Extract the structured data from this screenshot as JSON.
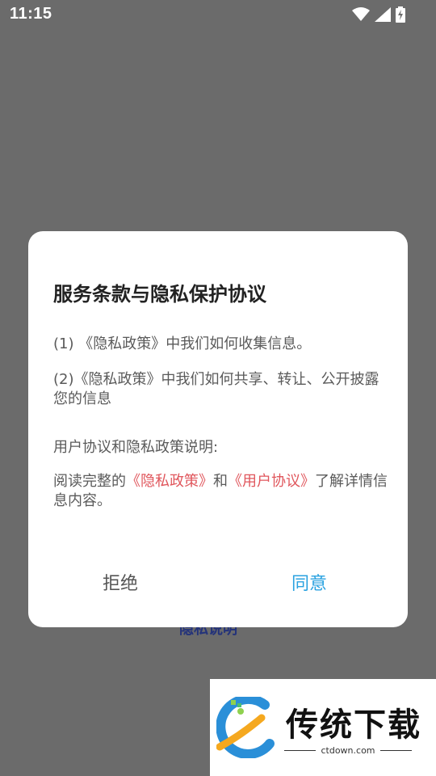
{
  "status_bar": {
    "time": "11:15",
    "icons": [
      "wifi-icon",
      "signal-icon",
      "battery-charging-icon"
    ]
  },
  "background_snippet": "隐私说明",
  "dialog": {
    "title": "服务条款与隐私保护协议",
    "item1": "(1) 《隐私政策》中我们如何收集信息。",
    "item2": "(2)《隐私政策》中我们如何共享、转让、公开披露您的信息",
    "section_label": "用户协议和隐私政策说明:",
    "read_prefix": "阅读完整的",
    "privacy_link": "《隐私政策》",
    "and_text": "和",
    "user_link": "《用户协议》",
    "read_suffix": "了解详情信息内容。",
    "reject_label": "拒绝",
    "agree_label": "同意"
  },
  "colors": {
    "overlay": "#6b6b6b",
    "link": "#e0565c",
    "agree": "#2aa2e0"
  },
  "watermark": {
    "text": "传统下载",
    "domain": "ctdown.com"
  }
}
